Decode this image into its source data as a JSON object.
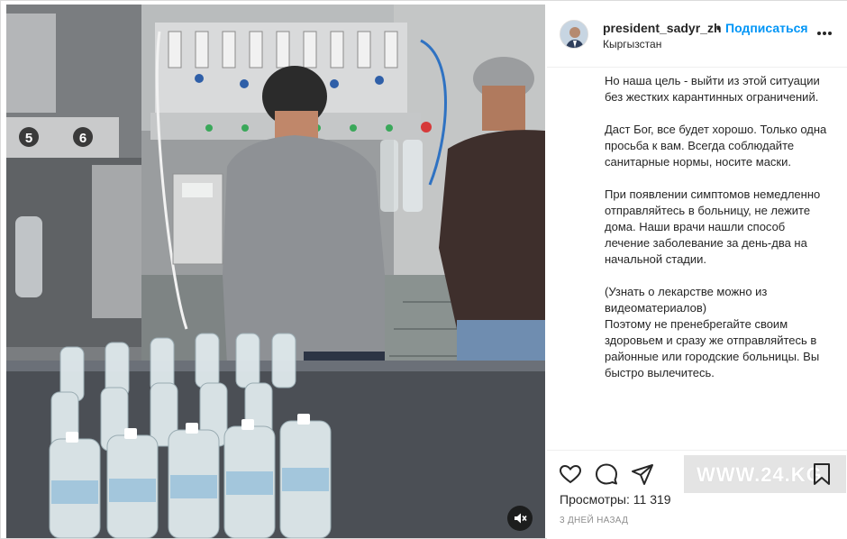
{
  "post": {
    "username": "president_sadyr_zh",
    "separator": "•",
    "follow_label": "Подписаться",
    "location": "Кыргызстан",
    "more_icon": "more-horizontal-icon"
  },
  "caption": {
    "paragraphs": [
      "Но наша цель - выйти из этой ситуации без жестких карантинных ограничений.",
      "Даст Бог, все будет хорошо. Только одна просьба к вам. Всегда соблюдайте санитарные нормы, носите маски.",
      "При появлении симптомов немедленно отправляйтесь в больницу, не лежите дома. Наши врачи нашли способ лечение заболевание за день-два на начальной стадии.",
      "(Узнать о лекарстве можно из видеоматериалов)",
      "Поэтому не пренебрегайте своим здоровьем и сразу же отправляйтесь в районные или городские больницы. Вы быстро вылечитесь."
    ]
  },
  "actions": {
    "like_icon": "heart-icon",
    "comment_icon": "comment-icon",
    "share_icon": "paper-plane-icon",
    "save_icon": "bookmark-icon",
    "views_label": "Просмотры:",
    "views_count": "11 319",
    "timestamp": "3 дней назад"
  },
  "media": {
    "kind": "video",
    "mute_icon": "speaker-muted-icon",
    "machine_labels": [
      "5",
      "6"
    ]
  },
  "watermark": {
    "text": "WWW.24.KG"
  },
  "colors": {
    "link_blue": "#0095f6",
    "text": "#262626",
    "muted": "#8e8e8e",
    "border": "#dbdbdb"
  }
}
